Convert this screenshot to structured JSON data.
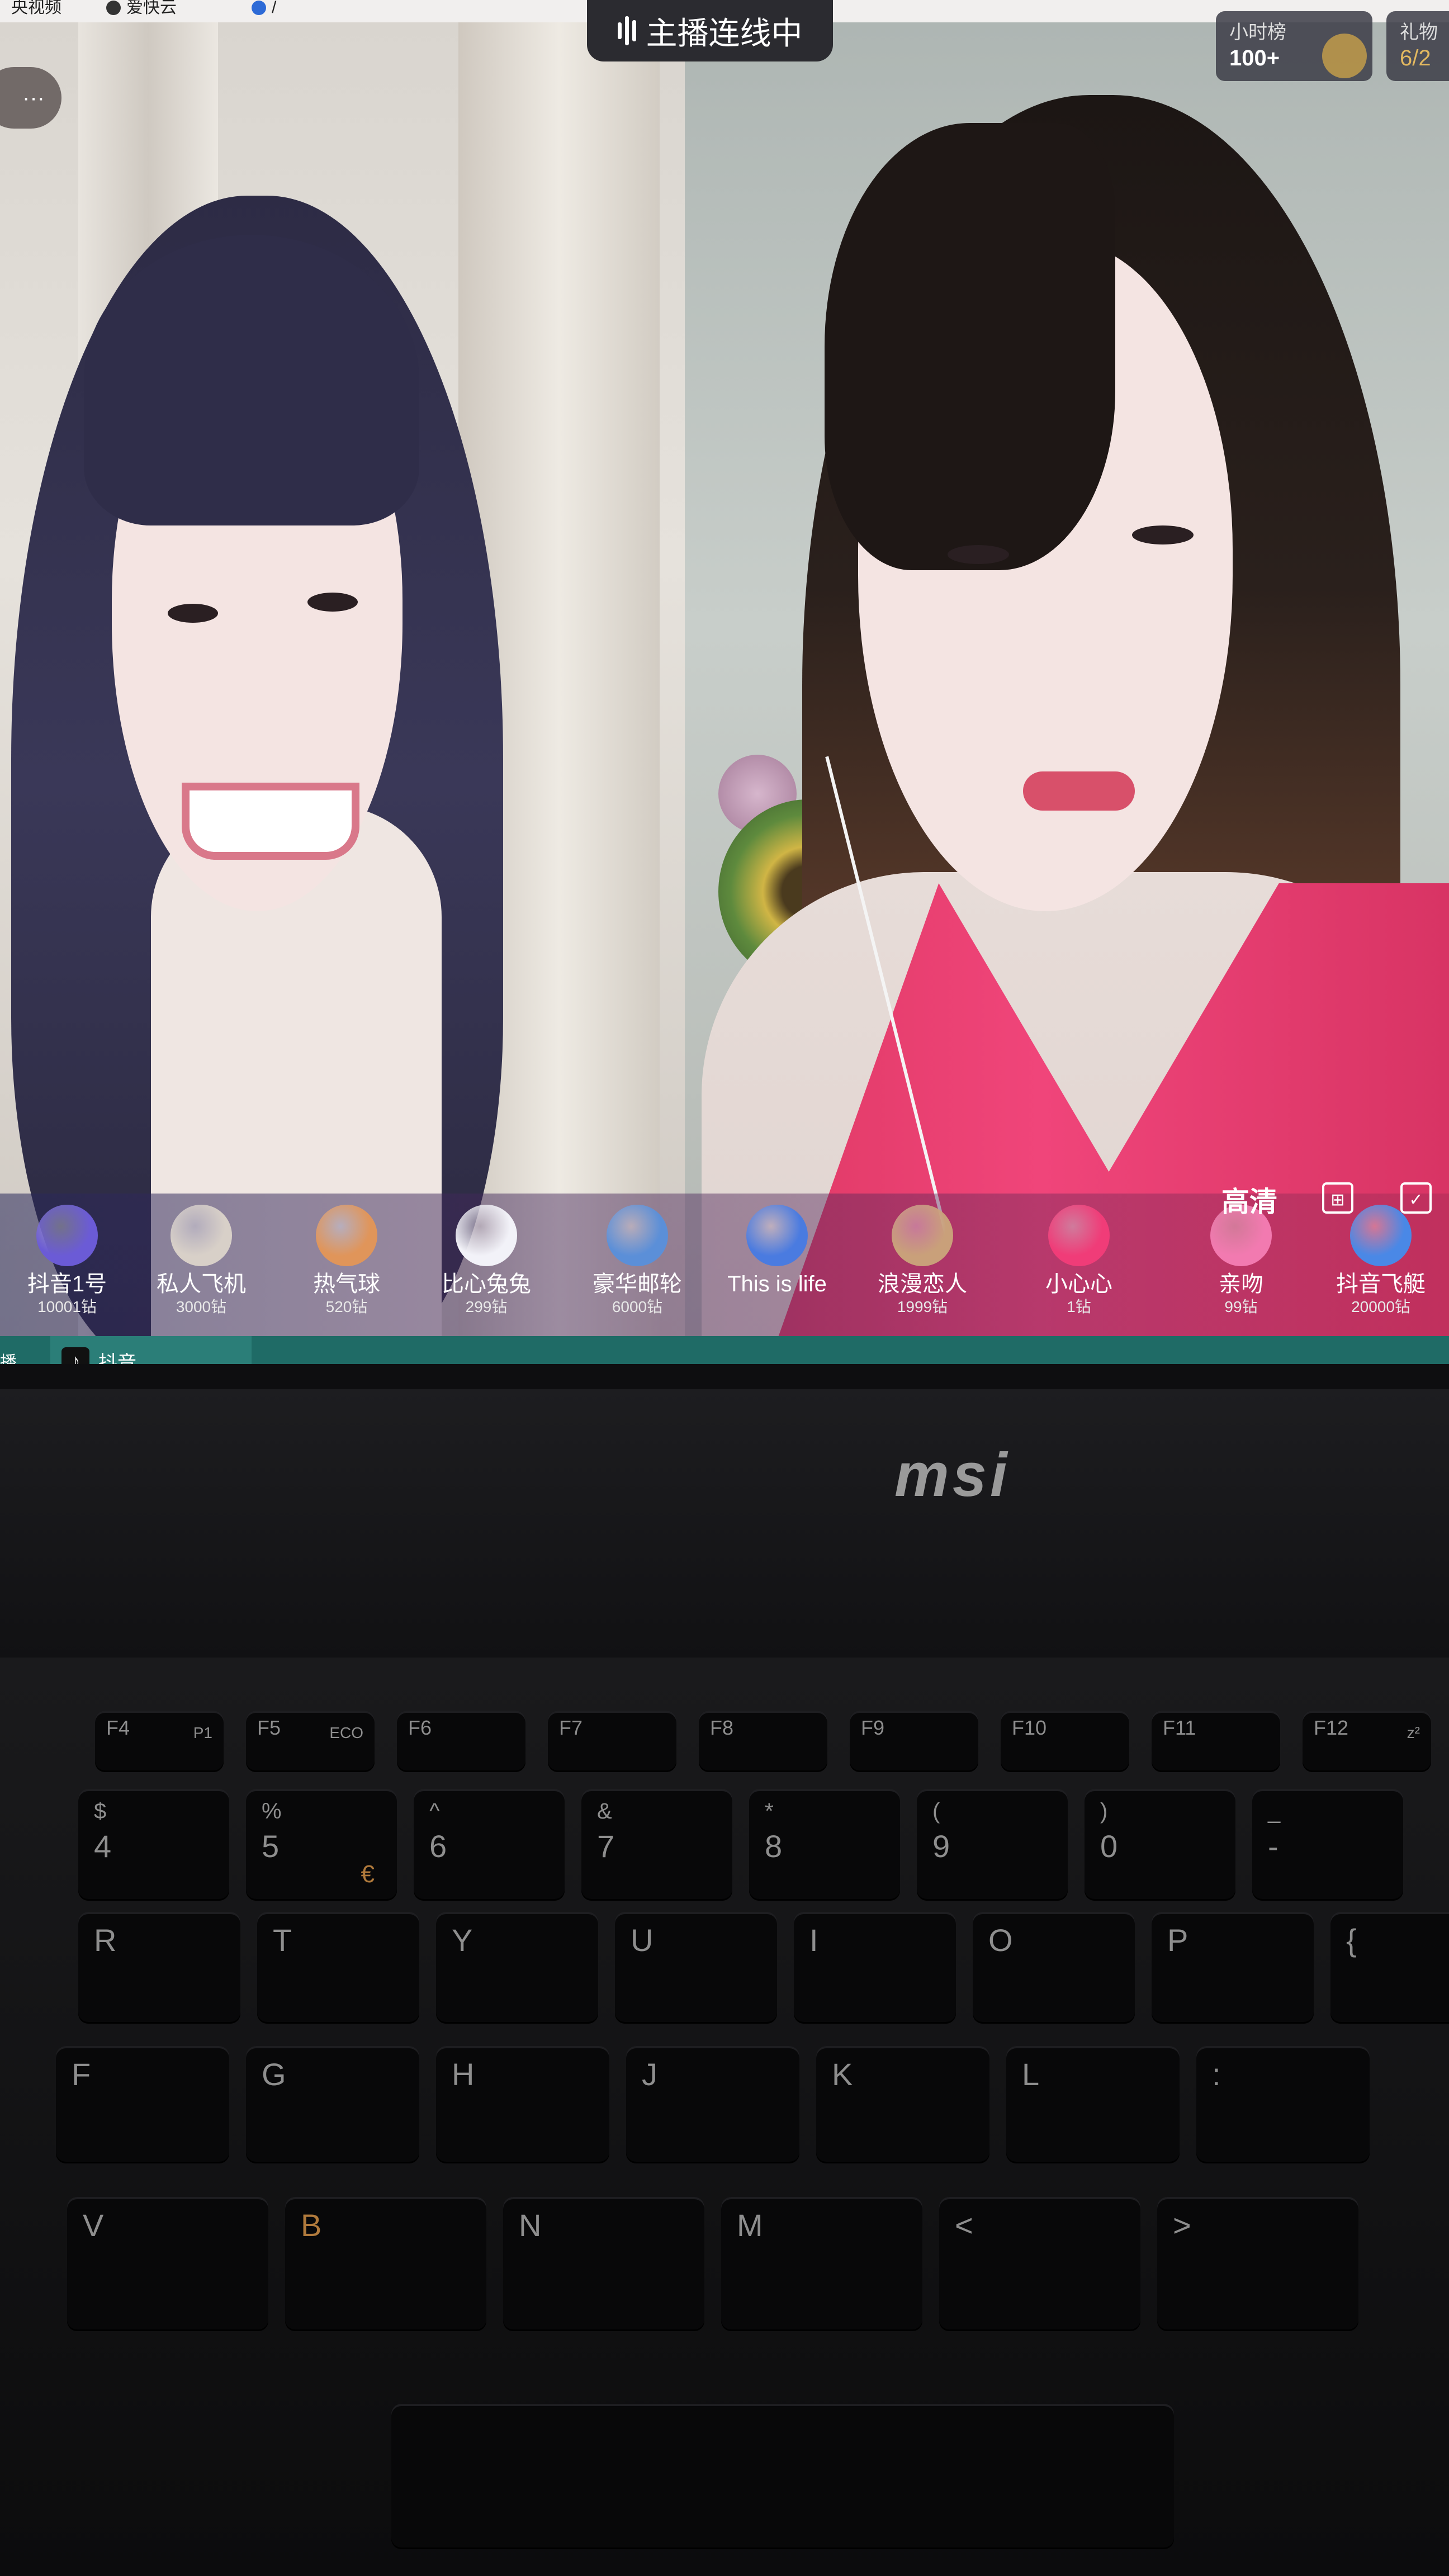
{
  "browser_tabs": [
    {
      "label": "央视频"
    },
    {
      "label": "爱快云"
    },
    {
      "label": "/"
    }
  ],
  "live": {
    "badge": "主播连线中",
    "menu_dots": "···"
  },
  "rank": {
    "title": "小时榜",
    "value": "100+"
  },
  "gift_stat": {
    "title": "礼物",
    "value": "6/2"
  },
  "controls": {
    "quality": "高清"
  },
  "gifts": [
    {
      "name": "抖音1号",
      "price": "10001钻",
      "color": "#6b5bd6"
    },
    {
      "name": "私人飞机",
      "price": "3000钻",
      "color": "#d8d0c8"
    },
    {
      "name": "热气球",
      "price": "520钻",
      "color": "#e0955a"
    },
    {
      "name": "比心兔兔",
      "price": "299钻",
      "color": "#f2f2f8"
    },
    {
      "name": "豪华邮轮",
      "price": "6000钻",
      "color": "#5b8fd8"
    },
    {
      "name": "This is life",
      "price": "",
      "color": "#4a7be0"
    },
    {
      "name": "浪漫恋人",
      "price": "1999钻",
      "color": "#c9a07a"
    },
    {
      "name": "小心心",
      "price": "1钻",
      "color": "#f03c78"
    },
    {
      "name": "亲吻",
      "price": "99钻",
      "color": "#f27ab0"
    },
    {
      "name": "抖音飞艇",
      "price": "20000钻",
      "color": "#4a88e6"
    }
  ],
  "taskbar": {
    "start_label": "播.",
    "app_label": "抖音",
    "app_icon": "tiktok-icon"
  },
  "laptop": {
    "brand": "msi"
  },
  "keyboard": {
    "fn_row": [
      "F4",
      "F5",
      "F6",
      "F7",
      "F8",
      "F9",
      "F10",
      "F11",
      "F12"
    ],
    "fn_sub": [
      "P1",
      "ECO",
      "",
      "",
      "",
      "",
      "",
      "",
      "z²"
    ],
    "num_row": [
      {
        "top": "$",
        "bottom": "4"
      },
      {
        "top": "%",
        "bottom": "5",
        "alt": "€"
      },
      {
        "top": "^",
        "bottom": "6"
      },
      {
        "top": "&",
        "bottom": "7"
      },
      {
        "top": "*",
        "bottom": "8"
      },
      {
        "top": "(",
        "bottom": "9"
      },
      {
        "top": ")",
        "bottom": "0"
      },
      {
        "top": "_",
        "bottom": "-"
      }
    ],
    "row_q": [
      "R",
      "T",
      "Y",
      "U",
      "I",
      "O",
      "P",
      "{"
    ],
    "row_a": [
      "F",
      "G",
      "H",
      "J",
      "K",
      "L",
      ":"
    ],
    "row_z": [
      "V",
      "B",
      "N",
      "M",
      "<",
      ">"
    ],
    "b_alt": "B"
  }
}
